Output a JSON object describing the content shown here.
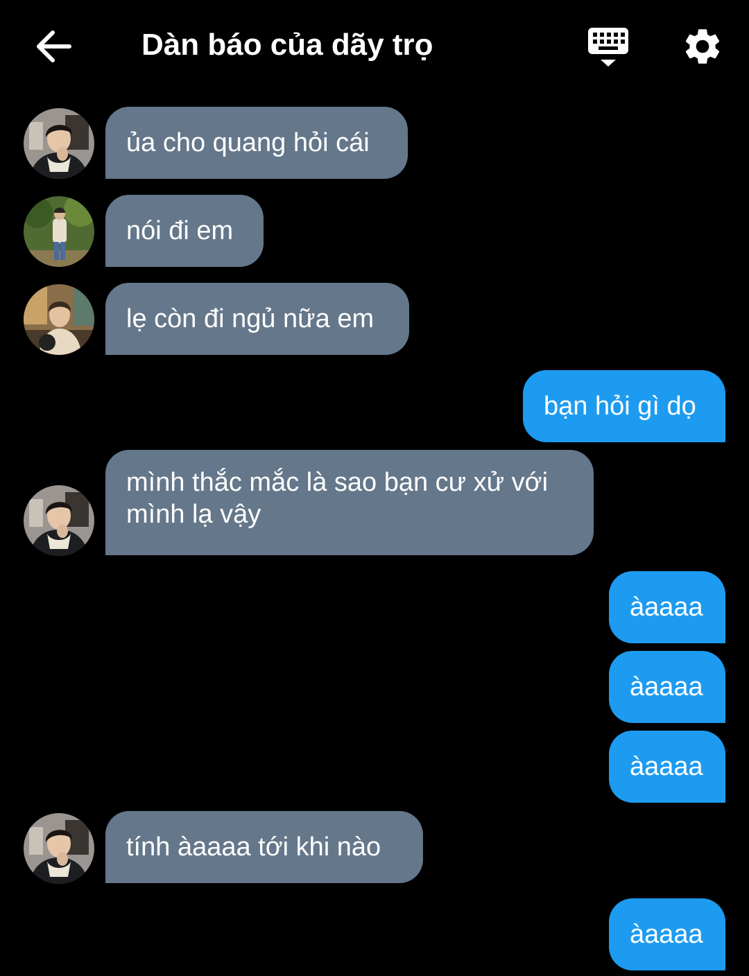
{
  "header": {
    "title": "Dàn báo của dãy trọ",
    "back_icon": "arrow-left-icon",
    "keyboard_icon": "keyboard-icon",
    "settings_icon": "gear-icon"
  },
  "colors": {
    "background": "#000000",
    "incoming_bubble": "#65778a",
    "outgoing_bubble": "#1d9bf0"
  },
  "messages": [
    {
      "sender": "other",
      "avatar": "avatar-1",
      "text": "ủa cho quang hỏi cái"
    },
    {
      "sender": "other",
      "avatar": "avatar-2",
      "text": "nói đi em"
    },
    {
      "sender": "other",
      "avatar": "avatar-3",
      "text": "lẹ còn đi ngủ nữa em"
    },
    {
      "sender": "me",
      "text": "bạn hỏi gì dọ"
    },
    {
      "sender": "other",
      "avatar": "avatar-1",
      "text": "mình thắc mắc là sao bạn cư xử với\nmình lạ vậy"
    },
    {
      "sender": "me",
      "text": "àaaaa"
    },
    {
      "sender": "me",
      "text": "àaaaa"
    },
    {
      "sender": "me",
      "text": "àaaaa"
    },
    {
      "sender": "other",
      "avatar": "avatar-1",
      "text": "tính àaaaa tới khi nào"
    },
    {
      "sender": "me",
      "text": "àaaaa"
    }
  ]
}
